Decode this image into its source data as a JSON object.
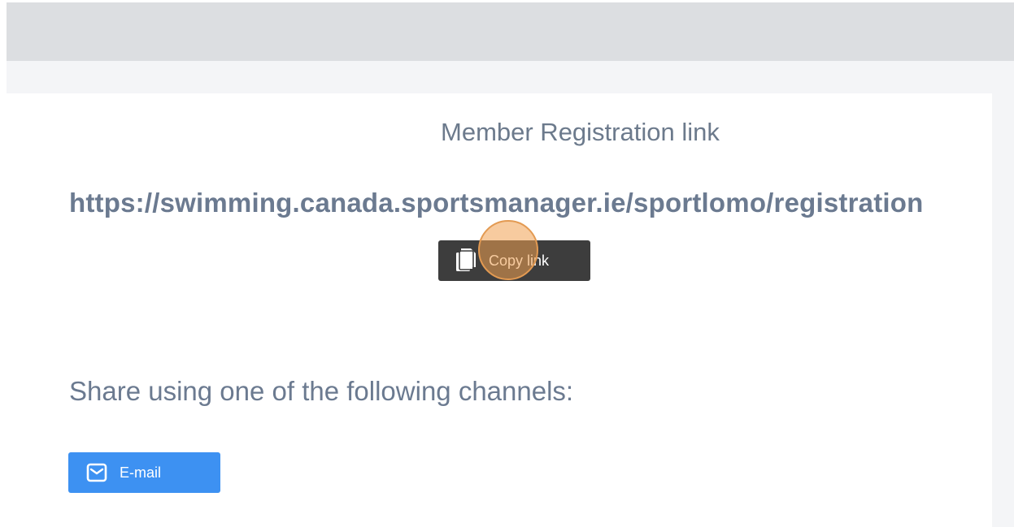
{
  "modal": {
    "title": "Member Registration link",
    "registration_url": "https://swimming.canada.sportsmanager.ie/sportlomo/registration",
    "copy_button": {
      "label": "Copy link",
      "icon": "copy-icon"
    },
    "share_heading": "Share using one of the following channels:",
    "share_channels": [
      {
        "label": "E-mail",
        "icon": "envelope-icon"
      }
    ]
  },
  "colors": {
    "top_bar": "#dcdee1",
    "sub_bar": "#f4f5f7",
    "text_primary": "#6b7a90",
    "copy_button_bg": "#3d3d3d",
    "email_button_bg": "#3d91f2",
    "click_highlight": "#f0a050"
  }
}
